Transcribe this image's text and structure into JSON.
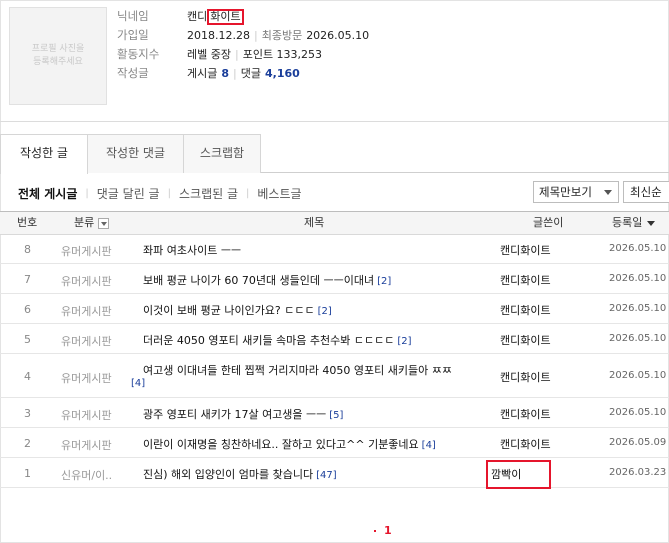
{
  "profile": {
    "photo_text": "프로필 사진을\n등록해주세요",
    "nickname_label": "닉네임",
    "nickname_prefix": "캔디",
    "nickname_highlight": "화이트",
    "joined_label": "가입일",
    "joined_date": "2018.12.28",
    "last_visit_label": "최종방문",
    "last_visit_date": "2026.05.10",
    "activity_label": "활동지수",
    "level_text": "레벨 중장",
    "points_text": "포인트 133,253",
    "posts_label": "작성글",
    "posts_text": "게시글",
    "posts_count": "8",
    "comments_text": "댓글",
    "comments_count": "4,160"
  },
  "tabs": [
    {
      "label": "작성한 글",
      "active": true
    },
    {
      "label": "작성한 댓글",
      "active": false
    },
    {
      "label": "스크랩함",
      "active": false
    }
  ],
  "filters": [
    "전체 게시글",
    "댓글 달린 글",
    "스크랩된 글",
    "베스트글"
  ],
  "view_select": "제목만보기",
  "sort_button": "최신순",
  "table": {
    "headers": {
      "num": "번호",
      "category": "분류",
      "title": "제목",
      "author": "글쓴이",
      "date": "등록일"
    },
    "rows": [
      {
        "num": "8",
        "category": "유머게시판",
        "title": "좌파 여초사이트 ㅡㅡ",
        "count": "",
        "author": "캔디화이트",
        "date": "2026.05.10"
      },
      {
        "num": "7",
        "category": "유머게시판",
        "title": "보배 평균 나이가 60 70년대 생들인데 ㅡㅡ이대녀",
        "count": "[2]",
        "author": "캔디화이트",
        "date": "2026.05.10"
      },
      {
        "num": "6",
        "category": "유머게시판",
        "title": "이것이 보배 평균 나이인가요? ㄷㄷㄷ",
        "count": "[2]",
        "author": "캔디화이트",
        "date": "2026.05.10"
      },
      {
        "num": "5",
        "category": "유머게시판",
        "title": "더러운 4050 영포티 새키들 속마음 추천수봐 ㄷㄷㄷㄷ",
        "count": "[2]",
        "author": "캔디화이트",
        "date": "2026.05.10"
      },
      {
        "num": "4",
        "category": "유머게시판",
        "title": "여고생 이대녀들 한테 찝쩍 거리지마라 4050 영포티 새키들아 ㅉㅉ",
        "count": "[4]",
        "author": "캔디화이트",
        "date": "2026.05.10"
      },
      {
        "num": "3",
        "category": "유머게시판",
        "title": "광주 영포티 새키가 17살 여고생을 ㅡㅡ",
        "count": "[5]",
        "author": "캔디화이트",
        "date": "2026.05.10"
      },
      {
        "num": "2",
        "category": "유머게시판",
        "title": "이란이 이재명을 칭찬하네요.. 잘하고 있다고^^ 기분좋네요",
        "count": "[4]",
        "author": "캔디화이트",
        "date": "2026.05.09"
      },
      {
        "num": "1",
        "category": "신유머/이..",
        "title": "진심) 해외 입양인이 엄마를 찾습니다",
        "count": "[47]",
        "author": "깜빡이",
        "date": "2026.03.23"
      }
    ]
  },
  "pagination": {
    "current": "1"
  },
  "colors": {
    "highlight": "#e5152c",
    "count": "#1a3e9a"
  }
}
